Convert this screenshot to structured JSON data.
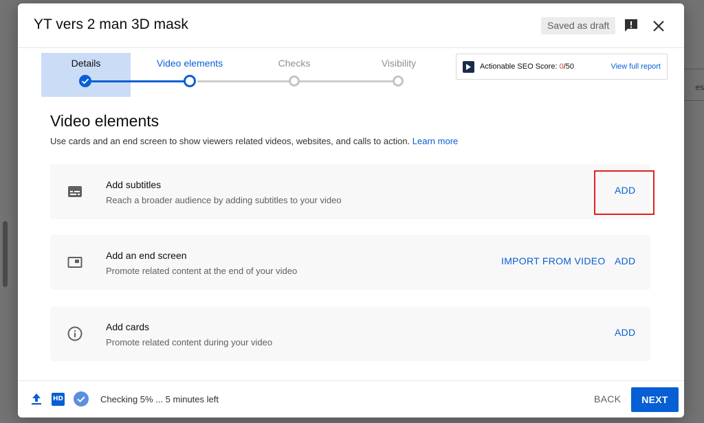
{
  "background": {
    "side_text": "es"
  },
  "dialog": {
    "title": "YT vers 2 man 3D mask",
    "draft_badge": "Saved as draft"
  },
  "stepper": {
    "steps": [
      {
        "label": "Details",
        "state": "complete"
      },
      {
        "label": "Video elements",
        "state": "current"
      },
      {
        "label": "Checks",
        "state": "pending"
      },
      {
        "label": "Visibility",
        "state": "pending"
      }
    ]
  },
  "seo": {
    "label": "Actionable SEO Score: ",
    "score": "0",
    "max": "/50",
    "link": "View full report"
  },
  "section": {
    "title": "Video elements",
    "description": "Use cards and an end screen to show viewers related videos, websites, and calls to action. ",
    "learn_more": "Learn more"
  },
  "cards": [
    {
      "title": "Add subtitles",
      "desc": "Reach a broader audience by adding subtitles to your video",
      "add": "ADD",
      "icon": "subtitles-icon"
    },
    {
      "title": "Add an end screen",
      "desc": "Promote related content at the end of your video",
      "import": "IMPORT FROM VIDEO",
      "add": "ADD",
      "icon": "end-screen-icon"
    },
    {
      "title": "Add cards",
      "desc": "Promote related content during your video",
      "add": "ADD",
      "icon": "info-icon"
    }
  ],
  "footer": {
    "hd_label": "HD",
    "status": "Checking 5% ... 5 minutes left",
    "back": "BACK",
    "next": "NEXT"
  },
  "colors": {
    "accent": "#065fd4",
    "highlight": "#e02020",
    "active_step_bg": "#cbdcf7"
  }
}
